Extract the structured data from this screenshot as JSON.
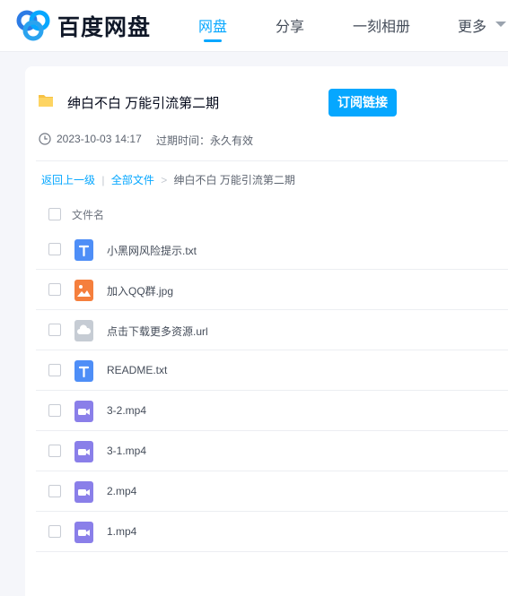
{
  "header": {
    "brand": "百度网盘",
    "nav": [
      {
        "label": "网盘",
        "active": true
      },
      {
        "label": "分享",
        "active": false
      },
      {
        "label": "一刻相册",
        "active": false
      },
      {
        "label": "更多",
        "active": false
      }
    ]
  },
  "share": {
    "title": "绅白不白 万能引流第二期",
    "subscribe_label": "订阅链接",
    "time": "2023-10-03 14:17",
    "expire": "过期时间：永久有效"
  },
  "breadcrumb": {
    "back": "返回上一级",
    "divider": "|",
    "all_files": "全部文件",
    "arrow": ">",
    "current": "绅白不白 万能引流第二期"
  },
  "table": {
    "column_name": "文件名"
  },
  "files": [
    {
      "name": "小黑网风险提示.txt",
      "icon": "txt-file-icon"
    },
    {
      "name": "加入QQ群.jpg",
      "icon": "image-file-icon"
    },
    {
      "name": "点击下载更多资源.url",
      "icon": "url-file-icon"
    },
    {
      "name": "README.txt",
      "icon": "txt-file-icon"
    },
    {
      "name": "3-2.mp4",
      "icon": "video-file-icon"
    },
    {
      "name": "3-1.mp4",
      "icon": "video-file-icon"
    },
    {
      "name": "2.mp4",
      "icon": "video-file-icon"
    },
    {
      "name": "1.mp4",
      "icon": "video-file-icon"
    }
  ],
  "colors": {
    "accent": "#06a7ff",
    "txt": "#4e8ef7",
    "image": "#f57f3d",
    "url": "#c6ccd4",
    "video": "#8a7fe9"
  }
}
